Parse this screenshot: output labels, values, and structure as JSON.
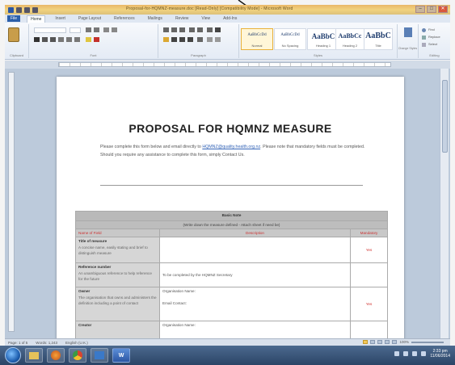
{
  "window": {
    "title": "Proposal-for-HQMNZ-measure.doc [Read-Only] [Compatibility Mode] - Microsoft Word",
    "minimize": "–",
    "maximize": "□",
    "close": "✕"
  },
  "tabs": [
    "File",
    "Home",
    "Insert",
    "Page Layout",
    "References",
    "Mailings",
    "Review",
    "View",
    "Add-Ins"
  ],
  "active_tab": "Home",
  "ribbon": {
    "clipboard_label": "Clipboard",
    "font_label": "Font",
    "paragraph_label": "Paragraph",
    "styles_label": "Styles",
    "editing_label": "Editing",
    "styles": [
      {
        "sample": "AaBbCcDd",
        "name": "Normal"
      },
      {
        "sample": "AaBbCcDd",
        "name": "No Spacing"
      },
      {
        "sample": "AaBbC",
        "name": "Heading 1"
      },
      {
        "sample": "AaBbCc",
        "name": "Heading 2"
      },
      {
        "sample": "AaBbC",
        "name": "Title"
      }
    ],
    "change_styles": "Change Styles",
    "editing": [
      "Find",
      "Replace",
      "Select"
    ]
  },
  "document": {
    "heading": "PROPOSAL FOR HQMNZ MEASURE",
    "intro_before": "Please complete this form below and email directly to ",
    "intro_email": "HQMNZ@quality.health.org.nz",
    "intro_after": ". Please note that mandatory fields must be completed. Should you require any assistance to complete this form, simply Contact Us.",
    "table": {
      "section_title": "Basic Note",
      "section_note": "(Write down the measure defined - Attach sheet if need be)",
      "headers": [
        "Name of Field",
        "Description",
        "Mandatory"
      ],
      "rows": [
        {
          "label": "Title of measure",
          "sublabel": "A concise name, easily stating and brief to distinguish measure",
          "description": "",
          "required": "Yes"
        },
        {
          "label": "Reference number",
          "sublabel": "An unambiguous reference to help reference for the future",
          "description": "To be completed by the HQMNZ Secretary",
          "required": ""
        },
        {
          "label": "Owner",
          "sublabel": "The organisation that owns and administers the definition including a point of contact",
          "description_lines": [
            "Organisation Name:",
            "Email Contact:"
          ],
          "required": "Yes"
        },
        {
          "label": "Creator",
          "sublabel": "",
          "description_lines": [
            "Organisation Name:"
          ],
          "required": ""
        }
      ]
    }
  },
  "statusbar": {
    "page": "Page: 1 of 5",
    "words": "Words: 1,243",
    "language": "English (U.K.)",
    "zoom": "100%"
  },
  "taskbar": {
    "apps": [
      "Explorer",
      "Firefox",
      "Chrome",
      "Outlook",
      "Word"
    ],
    "word_glyph": "W",
    "clock_time": "2:33 pm",
    "clock_date": "11/06/2014"
  }
}
